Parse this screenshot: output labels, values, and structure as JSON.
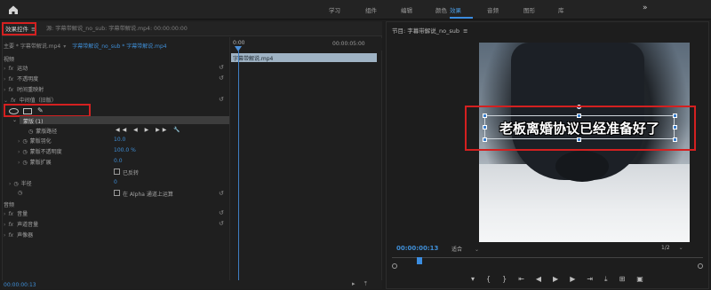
{
  "topbar": {
    "home_icon": "home-icon",
    "workspaces": [
      "学习",
      "组件",
      "编辑",
      "颜色",
      "效果",
      "音频",
      "图形",
      "库"
    ],
    "active_workspace": "效果",
    "more_icon": "double-chevron-right-icon"
  },
  "effect_controls": {
    "tab_label": "效果控件",
    "tab_menu": "≡",
    "tab2_label": "源: 字幕带解说_no_sub: 字幕带解说.mp4: 00:00:00:00",
    "source_label": "主要 * 字幕带解说.mp4",
    "source_arrow": "▾",
    "sequence_label": "字幕带解说_no_sub * 字幕带解说.mp4",
    "timeline_start": "0:00",
    "timeline_end": "00:00:05:00",
    "clip_label": "字幕带解说.mp4",
    "video_section": "视频",
    "rows": {
      "motion": "运动",
      "opacity": "不透明度",
      "time_remap": "时间重映射",
      "mosaic": "中间值（旧版）",
      "mask": "蒙版 (1)",
      "mask_path": "蒙版路径",
      "mask_feather": "蒙版羽化",
      "mask_opacity": "蒙版不透明度",
      "mask_expansion": "蒙版扩展",
      "radius": "半径",
      "inverted": "已反转",
      "alpha_apply": "在 Alpha 通道上运算"
    },
    "values": {
      "feather": "10.0",
      "opacity": "100.0 %",
      "expansion": "0.0",
      "radius": "0"
    },
    "audio_section": "音频",
    "audio_rows": {
      "volume": "音量",
      "channel_volume": "声道音量",
      "panner": "声像器"
    },
    "footer_timecode": "00:00:00:13"
  },
  "program": {
    "title": "节目: 字幕带解说_no_sub",
    "menu": "≡",
    "subtitle_text": "老板离婚协议已经准备好了",
    "timecode": "00:00:00:13",
    "fit_label": "适合",
    "ratio_label": "1/2"
  }
}
